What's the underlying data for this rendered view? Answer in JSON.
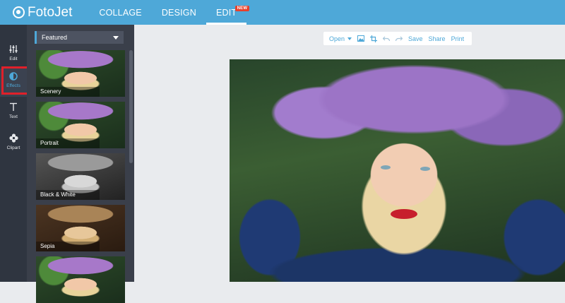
{
  "app": {
    "name": "FotoJet"
  },
  "nav": {
    "items": [
      {
        "label": "COLLAGE",
        "active": false
      },
      {
        "label": "DESIGN",
        "active": false
      },
      {
        "label": "EDIT",
        "active": true,
        "badge": "NEW"
      }
    ]
  },
  "rail": {
    "items": [
      {
        "label": "Edit",
        "icon": "sliders-icon"
      },
      {
        "label": "Effects",
        "icon": "half-circle-icon",
        "active": true
      },
      {
        "label": "Text",
        "icon": "text-t-icon"
      },
      {
        "label": "Clipart",
        "icon": "flower-icon"
      }
    ]
  },
  "panel": {
    "dropdown": {
      "selected": "Featured"
    },
    "effects": [
      {
        "label": "Scenery",
        "style": "color"
      },
      {
        "label": "Portrait",
        "style": "color"
      },
      {
        "label": "Black & White",
        "style": "bw"
      },
      {
        "label": "Sepia",
        "style": "sepia"
      },
      {
        "label": "",
        "style": "color"
      }
    ]
  },
  "toolbar": {
    "open": "Open",
    "save": "Save",
    "share": "Share",
    "print": "Print"
  },
  "colors": {
    "brand": "#4ea8d8",
    "highlight": "#e0202a",
    "rail": "#2f3540",
    "panel": "#3a3f4a"
  }
}
